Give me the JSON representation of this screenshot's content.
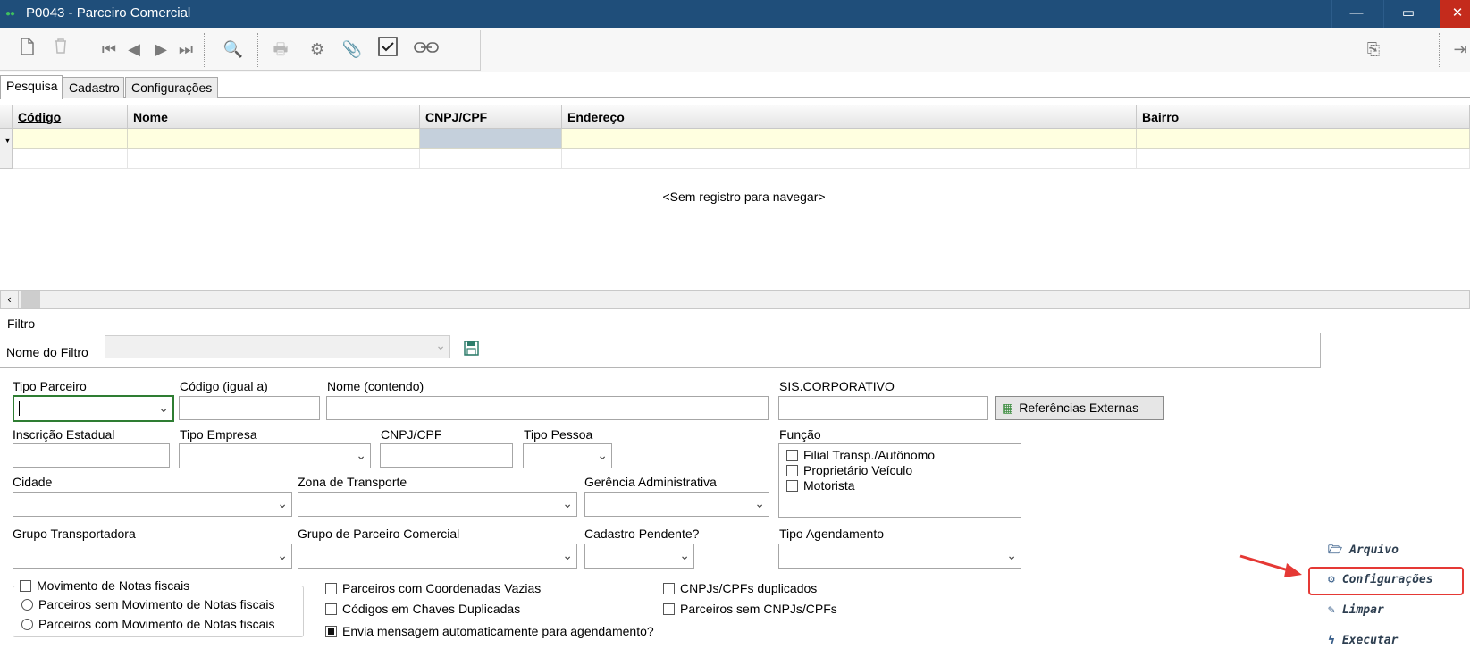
{
  "window": {
    "title": "P0043 - Parceiro Comercial",
    "minimize": "—",
    "maximize": "▭",
    "close": "✕"
  },
  "tabs": [
    {
      "label": "Pesquisa",
      "active": true
    },
    {
      "label": "Cadastro",
      "active": false
    },
    {
      "label": "Configurações",
      "active": false
    }
  ],
  "grid": {
    "columns": [
      "Código",
      "Nome",
      "CNPJ/CPF",
      "Endereço",
      "Bairro"
    ],
    "empty_message": "<Sem registro para navegar>"
  },
  "filter": {
    "section_label": "Filtro",
    "filter_name_label": "Nome do Filtro",
    "filter_name_value": ""
  },
  "fields": {
    "tipo_parceiro": {
      "label": "Tipo Parceiro",
      "value": ""
    },
    "codigo": {
      "label": "Código (igual a)",
      "value": ""
    },
    "nome": {
      "label": "Nome (contendo)",
      "value": ""
    },
    "sis_corporativo": {
      "label": "SIS.CORPORATIVO",
      "value": ""
    },
    "referencias_button": "Referências Externas",
    "inscricao": {
      "label": "Inscrição Estadual",
      "value": ""
    },
    "tipo_empresa": {
      "label": "Tipo Empresa",
      "value": ""
    },
    "cnpj_cpf": {
      "label": "CNPJ/CPF",
      "value": ""
    },
    "tipo_pessoa": {
      "label": "Tipo Pessoa",
      "value": ""
    },
    "funcao": {
      "label": "Função",
      "options": [
        "Filial Transp./Autônomo",
        "Proprietário Veículo",
        "Motorista"
      ]
    },
    "cidade": {
      "label": "Cidade",
      "value": ""
    },
    "zona": {
      "label": "Zona de Transporte",
      "value": ""
    },
    "gerencia": {
      "label": "Gerência Administrativa",
      "value": ""
    },
    "grupo_transp": {
      "label": "Grupo Transportadora",
      "value": ""
    },
    "grupo_parceiro": {
      "label": "Grupo de Parceiro Comercial",
      "value": ""
    },
    "cadastro_pendente": {
      "label": "Cadastro Pendente?",
      "value": ""
    },
    "tipo_agendamento": {
      "label": "Tipo Agendamento",
      "value": ""
    }
  },
  "movimento": {
    "label": "Movimento de Notas fiscais",
    "option_sem": "Parceiros sem Movimento de Notas fiscais",
    "option_com": "Parceiros com Movimento de Notas fiscais"
  },
  "checks": {
    "coordenadas": {
      "label": "Parceiros com Coordenadas Vazias",
      "checked": false
    },
    "chaves_duplicadas": {
      "label": "Códigos em Chaves Duplicadas",
      "checked": false
    },
    "envia_mensagem": {
      "label": "Envia mensagem automaticamente para agendamento?",
      "checked": true
    },
    "cnpjs_duplicados": {
      "label": "CNPJs/CPFs duplicados",
      "checked": false
    },
    "sem_cnpj": {
      "label": "Parceiros sem CNPJs/CPFs",
      "checked": false
    }
  },
  "actions": {
    "arquivo": "Arquivo",
    "configuracoes": "Configurações",
    "limpar": "Limpar",
    "executar": "Executar"
  },
  "annotation_color": "#e53935"
}
